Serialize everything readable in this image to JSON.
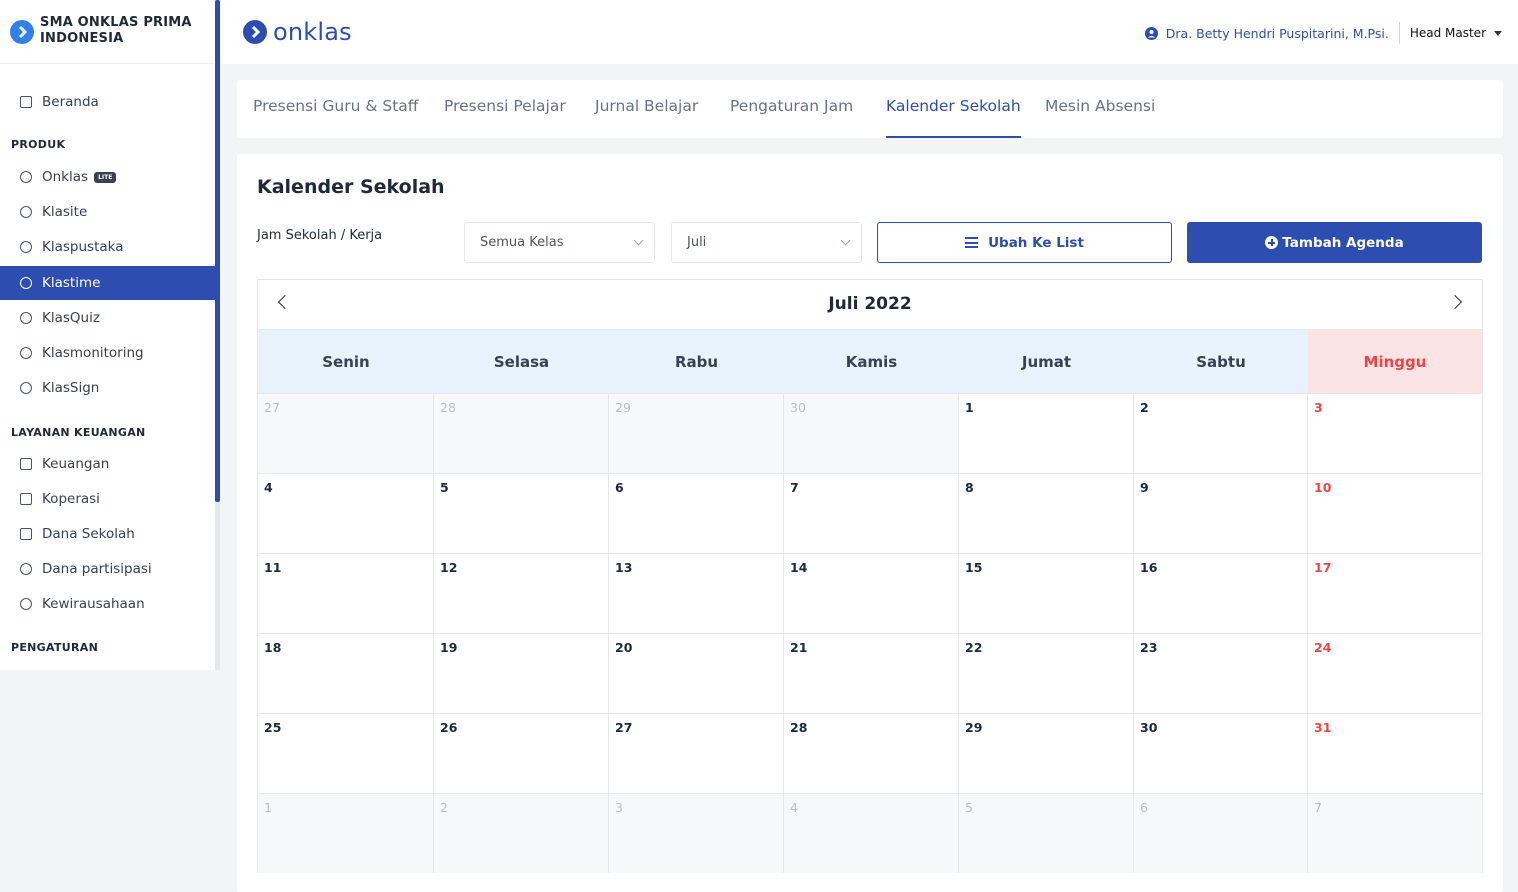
{
  "sidebar": {
    "school_name": "SMA ONKLAS PRIMA INDONESIA",
    "home": "Beranda",
    "sections": {
      "produk": "PRODUK",
      "keuangan": "LAYANAN KEUANGAN",
      "pengaturan": "PENGATURAN"
    },
    "produk_items": [
      "Onklas",
      "Klasite",
      "Klaspustaka",
      "Klastime",
      "KlasQuiz",
      "Klasmonitoring",
      "KlasSign"
    ],
    "lite_badge": "LITE",
    "keuangan_items": [
      "Keuangan",
      "Koperasi",
      "Dana Sekolah",
      "Dana partisipasi",
      "Kewirausahaan"
    ],
    "active_item": "Klastime"
  },
  "header": {
    "logo_text": "onklas",
    "user_name": "Dra. Betty Hendri Puspitarini, M.Psi.",
    "user_role": "Head Master"
  },
  "tabs": [
    "Presensi Guru & Staff",
    "Presensi Pelajar",
    "Jurnal Belajar",
    "Pengaturan Jam",
    "Kalender Sekolah",
    "Mesin Absensi"
  ],
  "active_tab": "Kalender Sekolah",
  "content": {
    "title": "Kalender Sekolah",
    "filter_label": "Jam Sekolah / Kerja",
    "class_select": "Semua Kelas",
    "month_select": "Juli",
    "list_button": "Ubah Ke List",
    "add_button": "Tambah Agenda"
  },
  "calendar": {
    "month_label": "Juli 2022",
    "weekdays": [
      "Senin",
      "Selasa",
      "Rabu",
      "Kamis",
      "Jumat",
      "Sabtu",
      "Minggu"
    ],
    "weeks": [
      [
        "27",
        "28",
        "29",
        "30",
        "1",
        "2",
        "3"
      ],
      [
        "4",
        "5",
        "6",
        "7",
        "8",
        "9",
        "10"
      ],
      [
        "11",
        "12",
        "13",
        "14",
        "15",
        "16",
        "17"
      ],
      [
        "18",
        "19",
        "20",
        "21",
        "22",
        "23",
        "24"
      ],
      [
        "25",
        "26",
        "27",
        "28",
        "29",
        "30",
        "31"
      ],
      [
        "1",
        "2",
        "3",
        "4",
        "5",
        "6",
        "7"
      ]
    ],
    "outside_month": [
      [
        true,
        true,
        true,
        true,
        false,
        false,
        false
      ],
      [
        false,
        false,
        false,
        false,
        false,
        false,
        false
      ],
      [
        false,
        false,
        false,
        false,
        false,
        false,
        false
      ],
      [
        false,
        false,
        false,
        false,
        false,
        false,
        false
      ],
      [
        false,
        false,
        false,
        false,
        false,
        false,
        false
      ],
      [
        true,
        true,
        true,
        true,
        true,
        true,
        true
      ]
    ]
  },
  "colors": {
    "primary": "#2d4eb0",
    "sunday": "#ef4444",
    "weekday_header": "#e8f2fd",
    "sunday_header": "#fde4e4"
  }
}
